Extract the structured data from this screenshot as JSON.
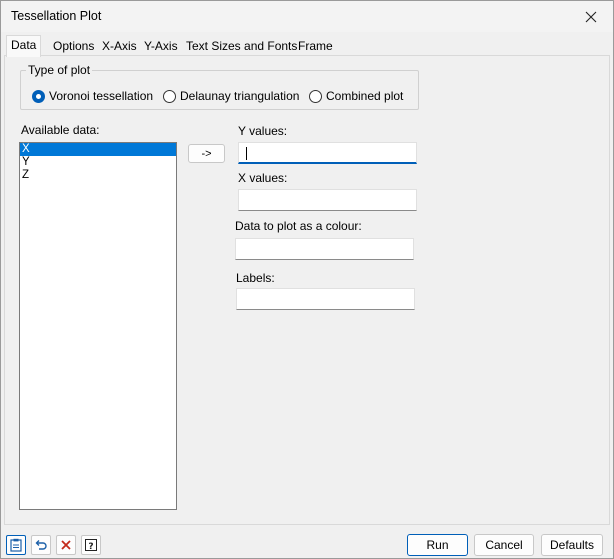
{
  "window": {
    "title": "Tessellation Plot"
  },
  "tabs": [
    {
      "label": "Data",
      "active": true
    },
    {
      "label": "Options"
    },
    {
      "label": "X-Axis"
    },
    {
      "label": "Y-Axis"
    },
    {
      "label": "Text Sizes and Fonts"
    },
    {
      "label": "Frame"
    }
  ],
  "type_of_plot": {
    "legend": "Type of plot",
    "options": [
      {
        "label": "Voronoi tessellation",
        "selected": true
      },
      {
        "label": "Delaunay triangulation",
        "selected": false
      },
      {
        "label": "Combined plot",
        "selected": false
      }
    ]
  },
  "available_data": {
    "label": "Available data:",
    "items": [
      "X",
      "Y",
      "Z"
    ],
    "selected_index": 0
  },
  "transfer_button": {
    "label": "->"
  },
  "fields": {
    "y_values": {
      "label": "Y values:",
      "value": ""
    },
    "x_values": {
      "label": "X values:",
      "value": ""
    },
    "colour": {
      "label": "Data to plot as a colour:",
      "value": ""
    },
    "labels": {
      "label": "Labels:",
      "value": ""
    }
  },
  "buttons": {
    "run": "Run",
    "cancel": "Cancel",
    "defaults": "Defaults"
  },
  "icon_buttons": [
    "clipboard-icon",
    "undo-icon",
    "clear-icon",
    "help-icon"
  ],
  "colors": {
    "accent": "#005fb8",
    "selection": "#0078d7",
    "clear_red": "#c42b1c"
  }
}
